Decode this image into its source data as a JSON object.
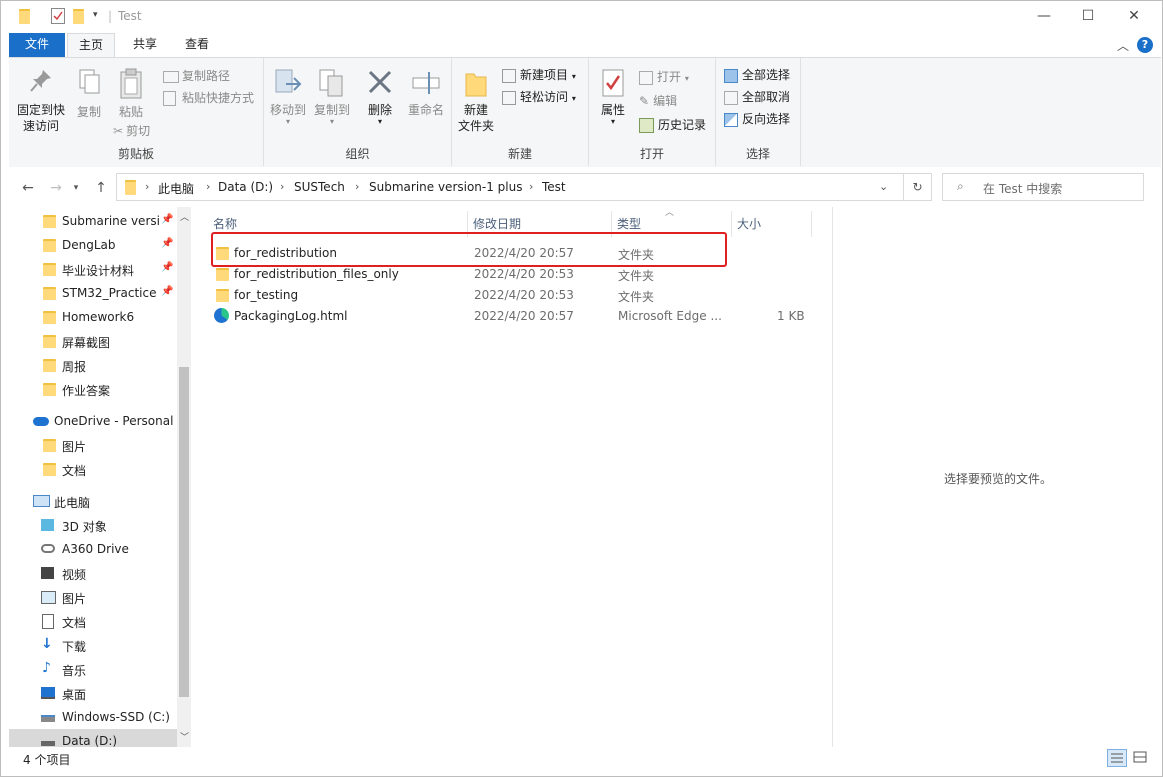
{
  "window": {
    "title": "Test"
  },
  "tabs": {
    "file": "文件",
    "home": "主页",
    "share": "共享",
    "view": "查看"
  },
  "ribbon": {
    "clipboard": {
      "pin": "固定到快\n速访问",
      "copy": "复制",
      "paste": "粘贴",
      "copy_path": "复制路径",
      "paste_shortcut": "粘贴快捷方式",
      "cut": "剪切",
      "label": "剪贴板"
    },
    "organize": {
      "move_to": "移动到",
      "copy_to": "复制到",
      "delete": "删除",
      "rename": "重命名",
      "label": "组织"
    },
    "new": {
      "new_folder": "新建\n文件夹",
      "new_item": "新建项目",
      "easy_access": "轻松访问",
      "label": "新建"
    },
    "open": {
      "properties": "属性",
      "open": "打开",
      "edit": "编辑",
      "history": "历史记录",
      "label": "打开"
    },
    "select": {
      "select_all": "全部选择",
      "select_none": "全部取消",
      "invert": "反向选择",
      "label": "选择"
    }
  },
  "address": {
    "crumbs": [
      "此电脑",
      "Data (D:)",
      "SUSTech",
      "Submarine version-1 plus",
      "Test"
    ],
    "search_placeholder": "在 Test 中搜索"
  },
  "nav": {
    "quick": [
      {
        "label": "Submarine versic",
        "pinned": true
      },
      {
        "label": "DengLab",
        "pinned": true
      },
      {
        "label": "毕业设计材料",
        "pinned": true
      },
      {
        "label": "STM32_Practice",
        "pinned": true
      },
      {
        "label": "Homework6",
        "pinned": false
      },
      {
        "label": "屏幕截图",
        "pinned": false
      },
      {
        "label": "周报",
        "pinned": false
      },
      {
        "label": "作业答案",
        "pinned": false
      }
    ],
    "onedrive": "OneDrive - Personal",
    "onedrive_items": [
      "图片",
      "文档"
    ],
    "thispc": "此电脑",
    "pc_items": [
      "3D 对象",
      "A360 Drive",
      "视频",
      "图片",
      "文档",
      "下载",
      "音乐",
      "桌面",
      "Windows-SSD (C:)",
      "Data (D:)"
    ]
  },
  "list": {
    "headers": {
      "name": "名称",
      "date": "修改日期",
      "type": "类型",
      "size": "大小"
    },
    "rows": [
      {
        "name": "for_redistribution",
        "date": "2022/4/20 20:57",
        "type": "文件夹",
        "size": "",
        "icon": "folder-icon"
      },
      {
        "name": "for_redistribution_files_only",
        "date": "2022/4/20 20:53",
        "type": "文件夹",
        "size": "",
        "icon": "folder-icon"
      },
      {
        "name": "for_testing",
        "date": "2022/4/20 20:53",
        "type": "文件夹",
        "size": "",
        "icon": "folder-icon"
      },
      {
        "name": "PackagingLog.html",
        "date": "2022/4/20 20:57",
        "type": "Microsoft Edge ...",
        "size": "1 KB",
        "icon": "edge-icon"
      }
    ]
  },
  "preview": {
    "message": "选择要预览的文件。"
  },
  "status": {
    "count": "4 个项目"
  }
}
